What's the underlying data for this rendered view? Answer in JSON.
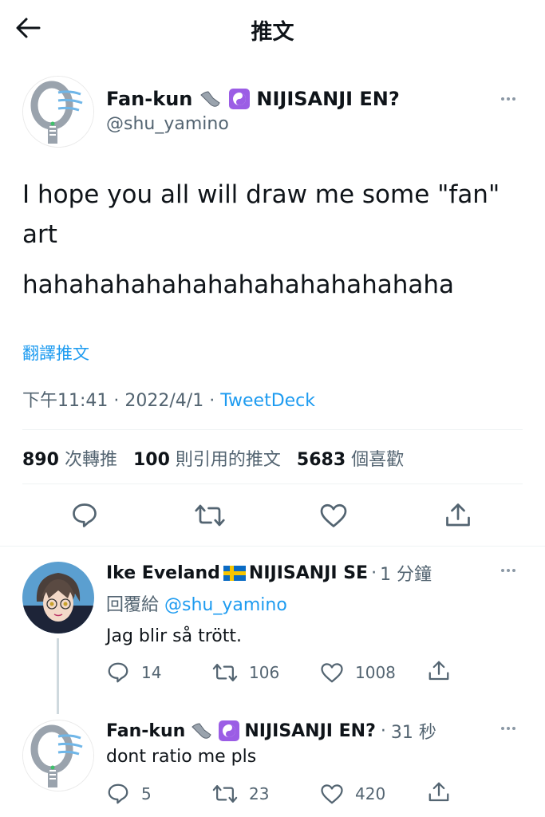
{
  "header": {
    "title": "推文"
  },
  "main_tweet": {
    "display_name": "Fan-kun",
    "badge": "NIJISANJI EN?",
    "handle": "@shu_yamino",
    "text_line1": "I hope you all will draw me some \"fan\"",
    "text_line2": "art",
    "text_line3": "hahahahahahahahahahahahahaha",
    "translate": "翻譯推文",
    "time": "下午11:41",
    "date": "2022/4/1",
    "source": "TweetDeck",
    "separator": "·",
    "stats": {
      "retweets": "890",
      "retweets_label": "次轉推",
      "quotes": "100",
      "quotes_label": "則引用的推文",
      "likes": "5683",
      "likes_label": "個喜歡"
    }
  },
  "replies": [
    {
      "display_name": "Ike Eveland",
      "badge": "NIJISANJI SE",
      "time": "1 分鐘",
      "reply_to_label": "回覆給",
      "reply_to": "@shu_yamino",
      "text": "Jag blir så trött.",
      "comments": "14",
      "retweets": "106",
      "likes": "1008"
    },
    {
      "display_name": "Fan-kun",
      "badge": "NIJISANJI EN?",
      "time": "31 秒",
      "text": "dont ratio me pls",
      "comments": "5",
      "retweets": "23",
      "likes": "420"
    }
  ],
  "colors": {
    "link": "#1d9bf0",
    "muted": "#536471",
    "text": "#0f1419",
    "badge": "#9b5de5"
  },
  "icons": [
    "back-arrow-icon",
    "more-icon",
    "reply-icon",
    "retweet-icon",
    "like-icon",
    "share-icon",
    "yin-yang-icon",
    "shoe-icon",
    "swedish-flag-icon"
  ]
}
